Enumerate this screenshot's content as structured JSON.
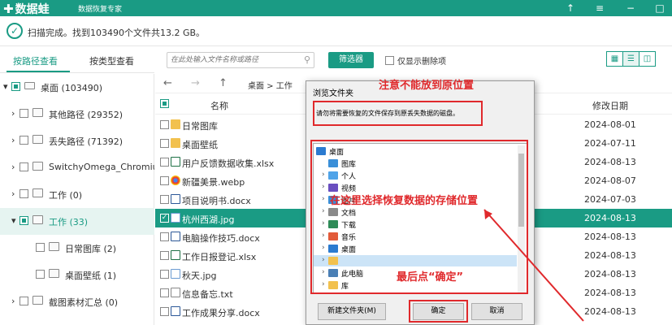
{
  "app": {
    "name": "数据蛙",
    "subtitle": "数据恢复专家",
    "colors": {
      "primary": "#1a9b84",
      "annotation": "#e0292c"
    }
  },
  "window_controls": {
    "upload_icon": "↑",
    "menu_icon": "≡",
    "minimize": "−"
  },
  "status": {
    "text": "扫描完成。找到103490个文件共13.2 GB。"
  },
  "tabs": [
    {
      "label": "按路径查看",
      "active": true
    },
    {
      "label": "按类型查看",
      "active": false
    }
  ],
  "toolbar": {
    "search_placeholder": "在此处输入文件名称或路径",
    "filter_label": "筛选器",
    "only_deleted_label": "仅显示删除项",
    "view_modes": [
      "grid",
      "list",
      "detail"
    ]
  },
  "tree": [
    {
      "label": "桌面 (103490)",
      "level": 0,
      "arrow": "▾",
      "checked": "partial",
      "icon": "pc"
    },
    {
      "label": "其他路径 (29352)",
      "level": 1,
      "arrow": "›",
      "checked": false,
      "icon": "folder"
    },
    {
      "label": "丢失路径 (71392)",
      "level": 1,
      "arrow": "›",
      "checked": false,
      "icon": "folder"
    },
    {
      "label": "SwitchyOmega_Chromium",
      "level": 1,
      "arrow": "›",
      "checked": false,
      "icon": "folder"
    },
    {
      "label": "工作 (0)",
      "level": 1,
      "arrow": "›",
      "checked": false,
      "icon": "folder"
    },
    {
      "label": "工作 (33)",
      "level": 1,
      "arrow": "▾",
      "checked": "partial",
      "icon": "folder",
      "selected": true
    },
    {
      "label": "日常图库 (2)",
      "level": 2,
      "arrow": "",
      "checked": false,
      "icon": "folder"
    },
    {
      "label": "桌面壁纸 (1)",
      "level": 2,
      "arrow": "",
      "checked": false,
      "icon": "folder"
    },
    {
      "label": "截图素材汇总 (0)",
      "level": 1,
      "arrow": "›",
      "checked": false,
      "icon": "folder"
    }
  ],
  "nav": {
    "back": "←",
    "forward": "→",
    "up": "↑",
    "breadcrumb": "桌面 > 工作"
  },
  "list": {
    "header": {
      "name": "名称",
      "date": "修改日期"
    },
    "rows": [
      {
        "name": "日常图库",
        "type": "folder",
        "date": "2024-08-01",
        "selected": false
      },
      {
        "name": "桌面壁纸",
        "type": "folder",
        "date": "2024-07-11",
        "selected": false
      },
      {
        "name": "用户反馈数据收集.xlsx",
        "type": "xlsx",
        "date": "2024-08-13",
        "selected": false
      },
      {
        "name": "新疆美景.webp",
        "type": "webp",
        "date": "2024-08-07",
        "selected": false
      },
      {
        "name": "项目说明书.docx",
        "type": "docx",
        "date": "2024-07-03",
        "selected": false
      },
      {
        "name": "杭州西湖.jpg",
        "type": "jpg",
        "date": "2024-08-13",
        "selected": true
      },
      {
        "name": "电脑操作技巧.docx",
        "type": "docx",
        "date": "2024-08-13",
        "selected": false
      },
      {
        "name": "工作日报登记.xlsx",
        "type": "xlsx",
        "date": "2024-08-13",
        "selected": false
      },
      {
        "name": "秋天.jpg",
        "type": "jpg",
        "date": "2024-08-13",
        "selected": false
      },
      {
        "name": "信息备忘.txt",
        "type": "txt",
        "date": "2024-08-13",
        "selected": false
      },
      {
        "name": "工作成果分享.docx",
        "type": "docx",
        "date": "2024-08-13",
        "selected": false
      }
    ]
  },
  "dialog": {
    "title": "浏览文件夹",
    "message": "请勿将需要恢复的文件保存到原丢失数据的磁盘。",
    "items": [
      {
        "label": "桌面",
        "level": 0,
        "arrow": "",
        "icon_color": "#2b7bd0"
      },
      {
        "label": "图库",
        "level": 1,
        "arrow": "",
        "icon_color": "#3a8fd8"
      },
      {
        "label": "个人",
        "level": 1,
        "arrow": "›",
        "icon_color": "#4fa3e8"
      },
      {
        "label": "视频",
        "level": 1,
        "arrow": "›",
        "icon_color": "#6a4fc0"
      },
      {
        "label": "图片",
        "level": 1,
        "arrow": "›",
        "icon_color": "#3a8fd8"
      },
      {
        "label": "文档",
        "level": 1,
        "arrow": "›",
        "icon_color": "#8a8a8a"
      },
      {
        "label": "下载",
        "level": 1,
        "arrow": "›",
        "icon_color": "#2e8b57"
      },
      {
        "label": "音乐",
        "level": 1,
        "arrow": "›",
        "icon_color": "#e25b3a"
      },
      {
        "label": "桌面",
        "level": 1,
        "arrow": "›",
        "icon_color": "#2b7bd0"
      },
      {
        "label": "",
        "level": 1,
        "arrow": "›",
        "icon_color": "#f2c14e",
        "highlight": true
      },
      {
        "label": "此电脑",
        "level": 1,
        "arrow": "›",
        "icon_color": "#4a7fb5"
      },
      {
        "label": "库",
        "level": 1,
        "arrow": "›",
        "icon_color": "#f2c14e"
      }
    ],
    "buttons": {
      "new_folder": "新建文件夹(M)",
      "ok": "确定",
      "cancel": "取消"
    }
  },
  "annotations": {
    "top": "注意不能放到原位置",
    "middle": "在这里选择恢复数据的存储位置",
    "bottom": "最后点“确定”"
  }
}
